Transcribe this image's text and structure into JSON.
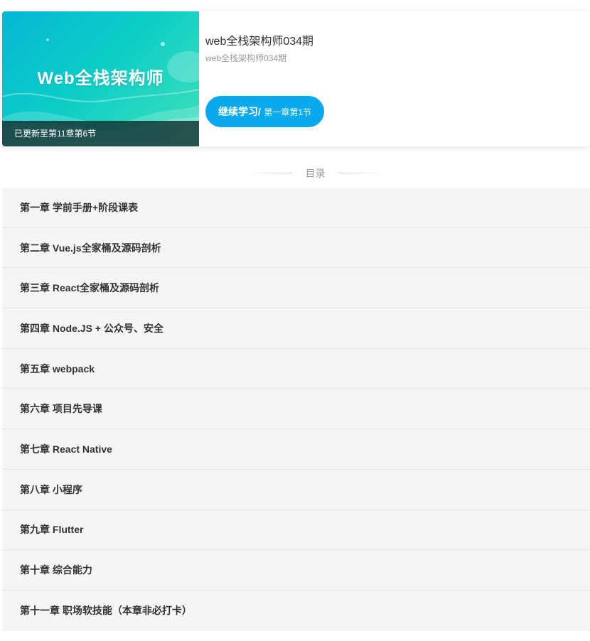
{
  "course": {
    "cover_title": "Web全栈架构师",
    "update_status": "已更新至第11章第6节",
    "name": "web全栈架构师034期",
    "subtitle": "web全栈架构师034期",
    "continue_label": "继续学习",
    "continue_separator": "/",
    "continue_progress": "第一章第1节"
  },
  "toc": {
    "label": "目录"
  },
  "chapters": [
    "第一章 学前手册+阶段课表",
    "第二章 Vue.js全家桶及源码剖析",
    "第三章 React全家桶及源码剖析",
    "第四章 Node.JS + 公众号、安全",
    "第五章 webpack",
    "第六章 项目先导课",
    "第七章 React Native",
    "第八章 小程序",
    "第九章 Flutter",
    "第十章 综合能力",
    "第十一章 职场软技能（本章非必打卡）"
  ],
  "colors": {
    "accent": "#0aa9ec",
    "cover_gradient_start": "#05b7d4",
    "cover_gradient_end": "#3fe0b8",
    "list_background": "#f5f5f5"
  }
}
